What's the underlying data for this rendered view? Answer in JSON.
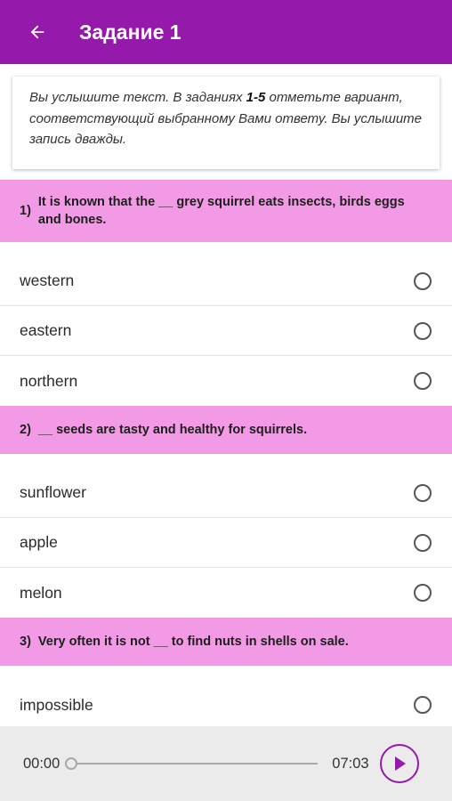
{
  "app_bar": {
    "title": "Задание 1",
    "back_icon": "arrow-left-icon",
    "color": "#9519aa"
  },
  "instructions": {
    "part1": "Вы услышите текст. В заданиях ",
    "range": "1-5",
    "part2": " отметьте вариант, соответствующий выбранному Вами ответу. Вы услышите запись дважды."
  },
  "questions": [
    {
      "number": "1)",
      "text": "It is known that the __ grey squirrel eats insects, birds eggs and bones.",
      "options": [
        "western",
        "eastern",
        "northern"
      ]
    },
    {
      "number": "2)",
      "text": "__ seeds are tasty and healthy for squirrels.",
      "options": [
        "sunflower",
        "apple",
        "melon"
      ]
    },
    {
      "number": "3)",
      "text": "Very often it is not __ to find nuts in shells on sale.",
      "options": [
        "impossible"
      ]
    }
  ],
  "player": {
    "current_time": "00:00",
    "duration": "07:03",
    "progress": 0,
    "play_icon": "play-icon"
  },
  "colors": {
    "question_bg": "#f39ae6",
    "accent": "#9519aa",
    "player_bg": "#ebebeb"
  }
}
